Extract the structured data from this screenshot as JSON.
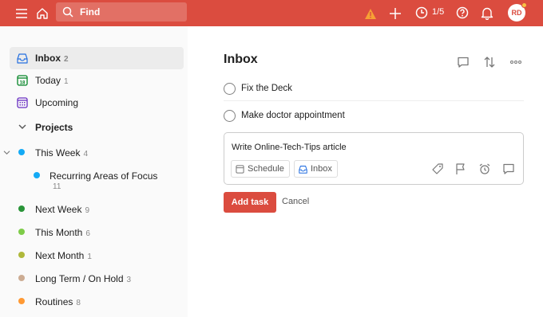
{
  "topbar": {
    "search_placeholder": "Find",
    "karma_progress": "1/5",
    "avatar_initials": "RD",
    "color": "#db4c3f"
  },
  "sidebar": {
    "items": [
      {
        "label": "Inbox",
        "count": "2",
        "icon": "inbox-icon",
        "active": true
      },
      {
        "label": "Today",
        "count": "1",
        "icon": "calendar-today-icon"
      },
      {
        "label": "Upcoming",
        "count": "",
        "icon": "calendar-upcoming-icon"
      }
    ],
    "projects_header": "Projects",
    "projects": [
      {
        "label": "This Week",
        "count": "4",
        "color": "#14aaf5"
      },
      {
        "label": "Recurring Areas of Focus",
        "count": "11",
        "color": "#14aaf5"
      },
      {
        "label": "Next Week",
        "count": "9",
        "color": "#299438"
      },
      {
        "label": "This Month",
        "count": "6",
        "color": "#7ecc49"
      },
      {
        "label": "Next Month",
        "count": "1",
        "color": "#afb83b"
      },
      {
        "label": "Long Term / On Hold",
        "count": "3",
        "color": "#ccac93"
      },
      {
        "label": "Routines",
        "count": "8",
        "color": "#ff9933"
      }
    ]
  },
  "main": {
    "title": "Inbox",
    "tasks": [
      {
        "label": "Fix the Deck"
      },
      {
        "label": "Make doctor appointment"
      }
    ],
    "editor": {
      "text": "Write Online-Tech-Tips article",
      "schedule_label": "Schedule",
      "project_label": "Inbox"
    },
    "add_task_label": "Add task",
    "cancel_label": "Cancel"
  }
}
